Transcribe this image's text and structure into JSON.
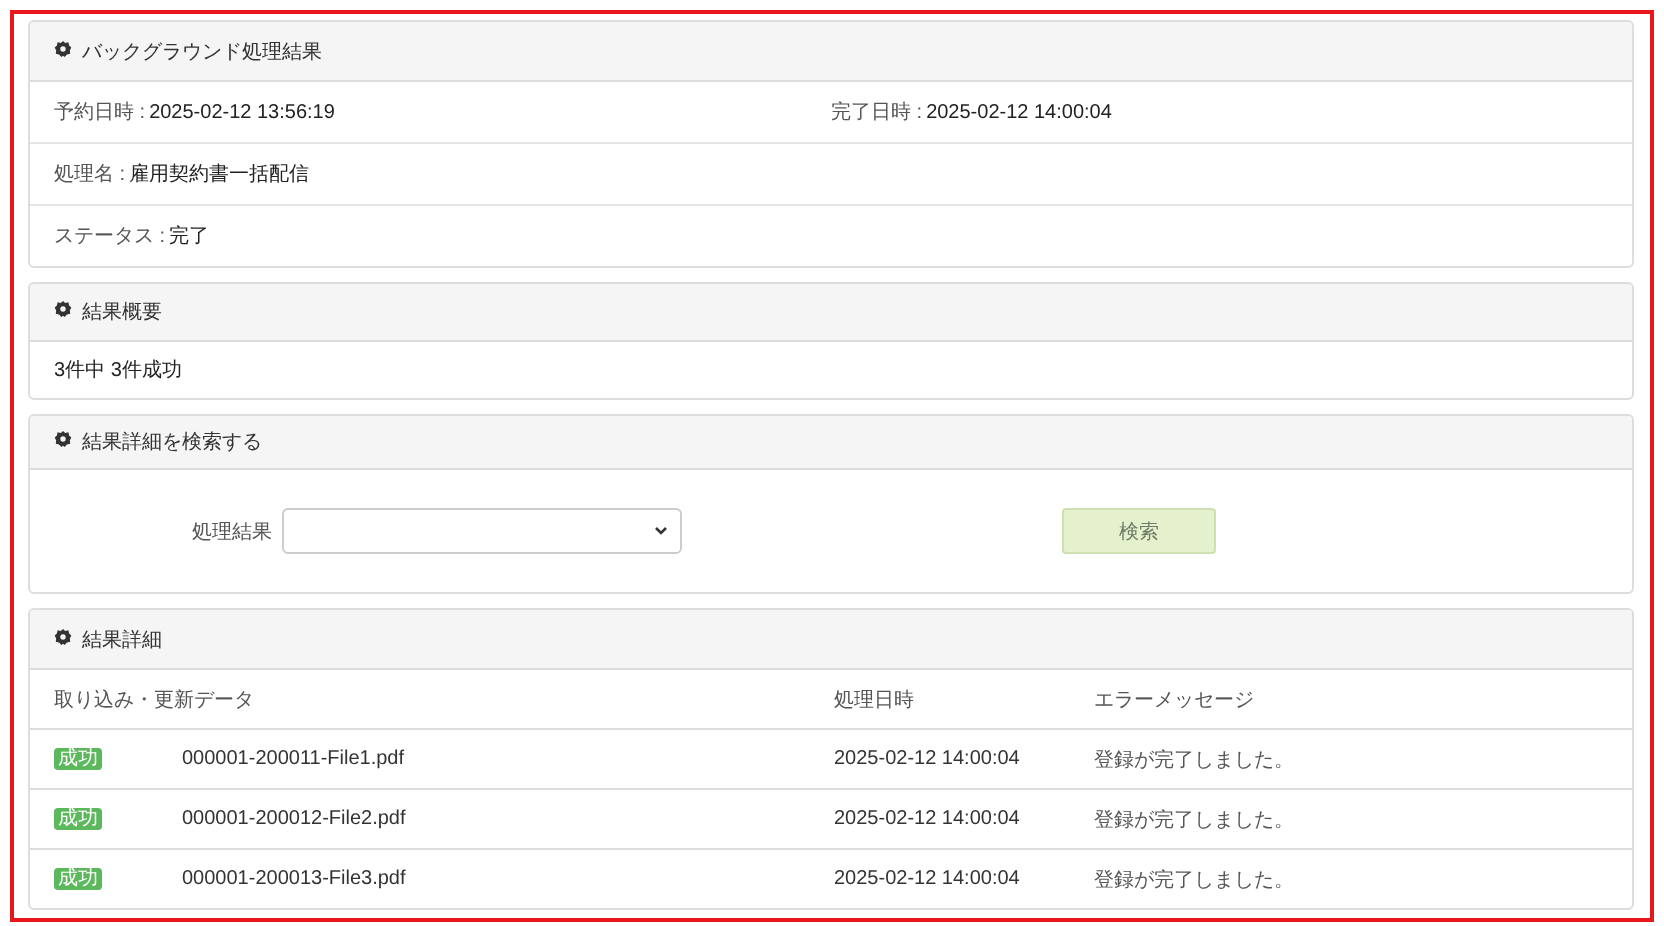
{
  "job_panel": {
    "title": "バックグラウンド処理結果",
    "fields": [
      {
        "label": "予約日時 :",
        "value": "2025-02-12 13:56:19"
      },
      {
        "label": "完了日時 :",
        "value": "2025-02-12 14:00:04"
      },
      {
        "label": "処理名 :",
        "value": "雇用契約書一括配信"
      },
      {
        "label": "ステータス :",
        "value": "完了"
      }
    ]
  },
  "summary_panel": {
    "title": "結果概要",
    "text": "3件中 3件成功"
  },
  "search_panel": {
    "title": "結果詳細を検索する",
    "filter_label": "処理結果",
    "button": "検索"
  },
  "detail_panel": {
    "title": "結果詳細",
    "columns": [
      "取り込み・更新データ",
      "処理日時",
      "エラーメッセージ"
    ],
    "rows": [
      {
        "status": "成功",
        "file": "000001-200011-File1.pdf",
        "date": "2025-02-12 14:00:04",
        "message": "登録が完了しました。"
      },
      {
        "status": "成功",
        "file": "000001-200012-File2.pdf",
        "date": "2025-02-12 14:00:04",
        "message": "登録が完了しました。"
      },
      {
        "status": "成功",
        "file": "000001-200013-File3.pdf",
        "date": "2025-02-12 14:00:04",
        "message": "登録が完了しました。"
      }
    ]
  }
}
